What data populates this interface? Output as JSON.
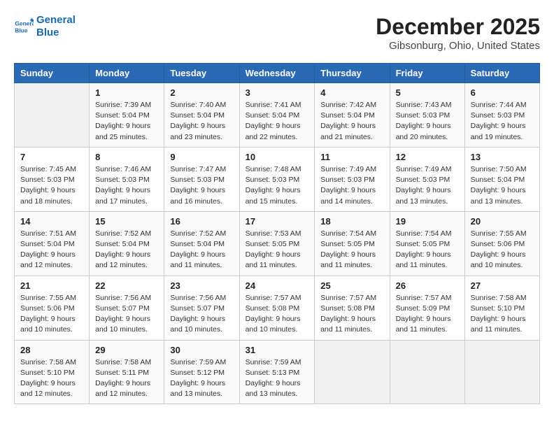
{
  "header": {
    "logo_line1": "General",
    "logo_line2": "Blue",
    "month_title": "December 2025",
    "location": "Gibsonburg, Ohio, United States"
  },
  "weekdays": [
    "Sunday",
    "Monday",
    "Tuesday",
    "Wednesday",
    "Thursday",
    "Friday",
    "Saturday"
  ],
  "weeks": [
    [
      {
        "day": "",
        "sunrise": "",
        "sunset": "",
        "daylight": ""
      },
      {
        "day": "1",
        "sunrise": "Sunrise: 7:39 AM",
        "sunset": "Sunset: 5:04 PM",
        "daylight": "Daylight: 9 hours and 25 minutes."
      },
      {
        "day": "2",
        "sunrise": "Sunrise: 7:40 AM",
        "sunset": "Sunset: 5:04 PM",
        "daylight": "Daylight: 9 hours and 23 minutes."
      },
      {
        "day": "3",
        "sunrise": "Sunrise: 7:41 AM",
        "sunset": "Sunset: 5:04 PM",
        "daylight": "Daylight: 9 hours and 22 minutes."
      },
      {
        "day": "4",
        "sunrise": "Sunrise: 7:42 AM",
        "sunset": "Sunset: 5:04 PM",
        "daylight": "Daylight: 9 hours and 21 minutes."
      },
      {
        "day": "5",
        "sunrise": "Sunrise: 7:43 AM",
        "sunset": "Sunset: 5:03 PM",
        "daylight": "Daylight: 9 hours and 20 minutes."
      },
      {
        "day": "6",
        "sunrise": "Sunrise: 7:44 AM",
        "sunset": "Sunset: 5:03 PM",
        "daylight": "Daylight: 9 hours and 19 minutes."
      }
    ],
    [
      {
        "day": "7",
        "sunrise": "Sunrise: 7:45 AM",
        "sunset": "Sunset: 5:03 PM",
        "daylight": "Daylight: 9 hours and 18 minutes."
      },
      {
        "day": "8",
        "sunrise": "Sunrise: 7:46 AM",
        "sunset": "Sunset: 5:03 PM",
        "daylight": "Daylight: 9 hours and 17 minutes."
      },
      {
        "day": "9",
        "sunrise": "Sunrise: 7:47 AM",
        "sunset": "Sunset: 5:03 PM",
        "daylight": "Daylight: 9 hours and 16 minutes."
      },
      {
        "day": "10",
        "sunrise": "Sunrise: 7:48 AM",
        "sunset": "Sunset: 5:03 PM",
        "daylight": "Daylight: 9 hours and 15 minutes."
      },
      {
        "day": "11",
        "sunrise": "Sunrise: 7:49 AM",
        "sunset": "Sunset: 5:03 PM",
        "daylight": "Daylight: 9 hours and 14 minutes."
      },
      {
        "day": "12",
        "sunrise": "Sunrise: 7:49 AM",
        "sunset": "Sunset: 5:03 PM",
        "daylight": "Daylight: 9 hours and 13 minutes."
      },
      {
        "day": "13",
        "sunrise": "Sunrise: 7:50 AM",
        "sunset": "Sunset: 5:04 PM",
        "daylight": "Daylight: 9 hours and 13 minutes."
      }
    ],
    [
      {
        "day": "14",
        "sunrise": "Sunrise: 7:51 AM",
        "sunset": "Sunset: 5:04 PM",
        "daylight": "Daylight: 9 hours and 12 minutes."
      },
      {
        "day": "15",
        "sunrise": "Sunrise: 7:52 AM",
        "sunset": "Sunset: 5:04 PM",
        "daylight": "Daylight: 9 hours and 12 minutes."
      },
      {
        "day": "16",
        "sunrise": "Sunrise: 7:52 AM",
        "sunset": "Sunset: 5:04 PM",
        "daylight": "Daylight: 9 hours and 11 minutes."
      },
      {
        "day": "17",
        "sunrise": "Sunrise: 7:53 AM",
        "sunset": "Sunset: 5:05 PM",
        "daylight": "Daylight: 9 hours and 11 minutes."
      },
      {
        "day": "18",
        "sunrise": "Sunrise: 7:54 AM",
        "sunset": "Sunset: 5:05 PM",
        "daylight": "Daylight: 9 hours and 11 minutes."
      },
      {
        "day": "19",
        "sunrise": "Sunrise: 7:54 AM",
        "sunset": "Sunset: 5:05 PM",
        "daylight": "Daylight: 9 hours and 11 minutes."
      },
      {
        "day": "20",
        "sunrise": "Sunrise: 7:55 AM",
        "sunset": "Sunset: 5:06 PM",
        "daylight": "Daylight: 9 hours and 10 minutes."
      }
    ],
    [
      {
        "day": "21",
        "sunrise": "Sunrise: 7:55 AM",
        "sunset": "Sunset: 5:06 PM",
        "daylight": "Daylight: 9 hours and 10 minutes."
      },
      {
        "day": "22",
        "sunrise": "Sunrise: 7:56 AM",
        "sunset": "Sunset: 5:07 PM",
        "daylight": "Daylight: 9 hours and 10 minutes."
      },
      {
        "day": "23",
        "sunrise": "Sunrise: 7:56 AM",
        "sunset": "Sunset: 5:07 PM",
        "daylight": "Daylight: 9 hours and 10 minutes."
      },
      {
        "day": "24",
        "sunrise": "Sunrise: 7:57 AM",
        "sunset": "Sunset: 5:08 PM",
        "daylight": "Daylight: 9 hours and 10 minutes."
      },
      {
        "day": "25",
        "sunrise": "Sunrise: 7:57 AM",
        "sunset": "Sunset: 5:08 PM",
        "daylight": "Daylight: 9 hours and 11 minutes."
      },
      {
        "day": "26",
        "sunrise": "Sunrise: 7:57 AM",
        "sunset": "Sunset: 5:09 PM",
        "daylight": "Daylight: 9 hours and 11 minutes."
      },
      {
        "day": "27",
        "sunrise": "Sunrise: 7:58 AM",
        "sunset": "Sunset: 5:10 PM",
        "daylight": "Daylight: 9 hours and 11 minutes."
      }
    ],
    [
      {
        "day": "28",
        "sunrise": "Sunrise: 7:58 AM",
        "sunset": "Sunset: 5:10 PM",
        "daylight": "Daylight: 9 hours and 12 minutes."
      },
      {
        "day": "29",
        "sunrise": "Sunrise: 7:58 AM",
        "sunset": "Sunset: 5:11 PM",
        "daylight": "Daylight: 9 hours and 12 minutes."
      },
      {
        "day": "30",
        "sunrise": "Sunrise: 7:59 AM",
        "sunset": "Sunset: 5:12 PM",
        "daylight": "Daylight: 9 hours and 13 minutes."
      },
      {
        "day": "31",
        "sunrise": "Sunrise: 7:59 AM",
        "sunset": "Sunset: 5:13 PM",
        "daylight": "Daylight: 9 hours and 13 minutes."
      },
      {
        "day": "",
        "sunrise": "",
        "sunset": "",
        "daylight": ""
      },
      {
        "day": "",
        "sunrise": "",
        "sunset": "",
        "daylight": ""
      },
      {
        "day": "",
        "sunrise": "",
        "sunset": "",
        "daylight": ""
      }
    ]
  ]
}
